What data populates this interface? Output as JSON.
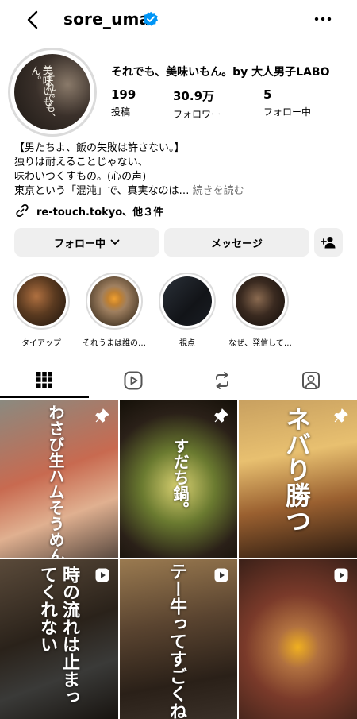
{
  "header": {
    "username": "sore_uma"
  },
  "profile": {
    "display_name": "それでも、美味いもん。by 大人男子LABO",
    "avatar_text_1": "それでも、",
    "avatar_text_2": "美味いもん。",
    "stats": [
      {
        "value": "199",
        "label": "投稿"
      },
      {
        "value": "30.9万",
        "label": "フォロワー"
      },
      {
        "value": "5",
        "label": "フォロー中"
      }
    ],
    "bio_lines": [
      "【男たちよ、飯の失敗は許さない。】",
      "独りは耐えることじゃない、",
      "味わいつくすもの。(心の声)",
      "東京という「混沌」で、真実なのは…"
    ],
    "read_more": "続きを読む",
    "link": "re-touch.tokyo、他３件"
  },
  "buttons": {
    "follow": "フォロー中",
    "message": "メッセージ"
  },
  "highlights": [
    {
      "label": "タイアップ",
      "color_a": "#7a4a2a",
      "color_b": "#2a1a10"
    },
    {
      "label": "それうまは誰の…",
      "color_a": "#d89a3a",
      "color_b": "#5a4020"
    },
    {
      "label": "視点",
      "color_a": "#3a4048",
      "color_b": "#101418"
    },
    {
      "label": "なぜ、発信して…",
      "color_a": "#6a5040",
      "color_b": "#181210"
    }
  ],
  "grid": [
    {
      "text": "わさび生ハムそうめん。",
      "kind": "pin",
      "bg": "linear-gradient(160deg,#8a8a80 0%,#c86a50 45%,#e0b090 70%,#5a4a40 100%)"
    },
    {
      "text": "すだち鍋。",
      "kind": "pin",
      "bg": "radial-gradient(circle at 50% 55%,#d8d070 0%,#6a7a30 35%,#2a2018 70%,#141008 100%)"
    },
    {
      "text": "ネバり勝つ",
      "kind": "pin",
      "bg": "linear-gradient(170deg,#c8a060 0%,#e8c070 35%,#9a6030 65%,#2a1a10 100%)"
    },
    {
      "text": "時の流れは止まってくれない",
      "kind": "reel",
      "bg": "linear-gradient(160deg,#5a4a3a 0%,#2a221a 45%,#3a3a38 70%,#181410 100%)"
    },
    {
      "text": "テー牛ってすごくね？",
      "kind": "reel",
      "bg": "linear-gradient(170deg,#9a7a50 0%,#5a4430 40%,#2a2018 75%,#3a3028 100%)"
    },
    {
      "text": "",
      "kind": "reel",
      "bg": "radial-gradient(circle at 50% 55%,#f0b020 0%,#b07040 20%,#7a3a2a 50%,#3a2018 100%)"
    }
  ],
  "colors": {
    "verified": "#0095f6",
    "button_bg": "#efefef",
    "ring": "#dbdbdb",
    "muted": "#737373"
  }
}
